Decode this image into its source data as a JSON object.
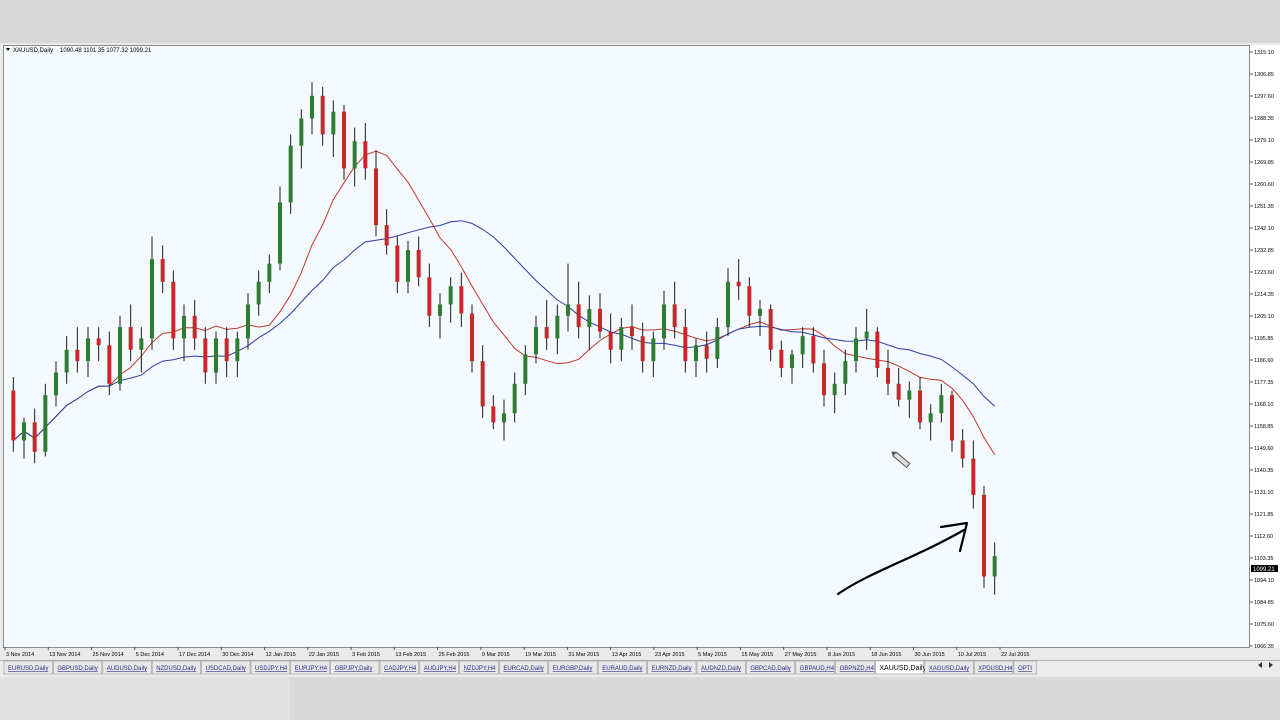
{
  "chart_data": {
    "type": "candlestick",
    "symbol_header": {
      "symbol": "XAUUSD,Daily",
      "ohlc": "1090.48 1101.35 1077.32 1099.21"
    },
    "y_ticks": [
      "1315.10",
      "1306.85",
      "1297.60",
      "1288.35",
      "1279.10",
      "1269.85",
      "1260.60",
      "1251.35",
      "1242.10",
      "1232.85",
      "1223.60",
      "1214.35",
      "1205.10",
      "1195.85",
      "1186.60",
      "1177.35",
      "1168.10",
      "1158.85",
      "1149.60",
      "1140.35",
      "1131.10",
      "1121.85",
      "1112.60",
      "1103.35",
      "1094.10",
      "1084.85",
      "1075.60",
      "1066.35"
    ],
    "current_price": "1099.21",
    "x_ticks": [
      "3 Nov 2014",
      "13 Nov 2014",
      "25 Nov 2014",
      "5 Dec 2014",
      "17 Dec 2014",
      "30 Dec 2014",
      "12 Jan 2015",
      "22 Jan 2015",
      "3 Feb 2015",
      "13 Feb 2015",
      "25 Feb 2015",
      "9 Mar 2015",
      "19 Mar 2015",
      "31 Mar 2015",
      "13 Apr 2015",
      "23 Apr 2015",
      "5 May 2015",
      "15 May 2015",
      "27 May 2015",
      "8 Jun 2015",
      "18 Jun 2015",
      "30 Jun 2015",
      "10 Jul 2015",
      "22 Jul 2015"
    ],
    "ylim": [
      1062,
      1320
    ],
    "colors": {
      "bull": "#2e7d32",
      "bear": "#c62828",
      "ma_fast": "#c0392b",
      "ma_slow": "#2c3e9e"
    },
    "ohlc_series": [
      [
        1172,
        1178,
        1145,
        1150
      ],
      [
        1150,
        1160,
        1142,
        1158
      ],
      [
        1158,
        1164,
        1140,
        1145
      ],
      [
        1145,
        1175,
        1143,
        1170
      ],
      [
        1170,
        1185,
        1165,
        1180
      ],
      [
        1180,
        1196,
        1175,
        1190
      ],
      [
        1190,
        1200,
        1180,
        1185
      ],
      [
        1185,
        1200,
        1178,
        1195
      ],
      [
        1195,
        1200,
        1185,
        1192
      ],
      [
        1192,
        1198,
        1170,
        1175
      ],
      [
        1175,
        1205,
        1172,
        1200
      ],
      [
        1200,
        1210,
        1185,
        1190
      ],
      [
        1190,
        1200,
        1180,
        1195
      ],
      [
        1195,
        1240,
        1190,
        1230
      ],
      [
        1230,
        1236,
        1215,
        1220
      ],
      [
        1220,
        1225,
        1190,
        1195
      ],
      [
        1195,
        1210,
        1185,
        1205
      ],
      [
        1205,
        1212,
        1190,
        1195
      ],
      [
        1195,
        1200,
        1175,
        1180
      ],
      [
        1180,
        1198,
        1175,
        1195
      ],
      [
        1195,
        1200,
        1178,
        1185
      ],
      [
        1185,
        1198,
        1178,
        1195
      ],
      [
        1195,
        1215,
        1190,
        1210
      ],
      [
        1210,
        1225,
        1205,
        1220
      ],
      [
        1220,
        1232,
        1215,
        1228
      ],
      [
        1228,
        1262,
        1225,
        1255
      ],
      [
        1255,
        1285,
        1250,
        1280
      ],
      [
        1280,
        1296,
        1270,
        1292
      ],
      [
        1292,
        1308,
        1285,
        1302
      ],
      [
        1302,
        1306,
        1280,
        1285
      ],
      [
        1285,
        1300,
        1275,
        1295
      ],
      [
        1295,
        1298,
        1265,
        1270
      ],
      [
        1270,
        1288,
        1262,
        1282
      ],
      [
        1282,
        1290,
        1265,
        1270
      ],
      [
        1270,
        1278,
        1240,
        1245
      ],
      [
        1245,
        1252,
        1232,
        1236
      ],
      [
        1236,
        1240,
        1215,
        1220
      ],
      [
        1220,
        1238,
        1215,
        1234
      ],
      [
        1234,
        1240,
        1218,
        1222
      ],
      [
        1222,
        1228,
        1200,
        1205
      ],
      [
        1205,
        1215,
        1195,
        1210
      ],
      [
        1210,
        1222,
        1202,
        1218
      ],
      [
        1218,
        1224,
        1200,
        1206
      ],
      [
        1206,
        1210,
        1180,
        1185
      ],
      [
        1185,
        1192,
        1160,
        1165
      ],
      [
        1165,
        1170,
        1155,
        1158
      ],
      [
        1158,
        1168,
        1150,
        1162
      ],
      [
        1162,
        1180,
        1158,
        1175
      ],
      [
        1175,
        1192,
        1170,
        1188
      ],
      [
        1188,
        1205,
        1184,
        1200
      ],
      [
        1200,
        1212,
        1190,
        1195
      ],
      [
        1195,
        1210,
        1188,
        1205
      ],
      [
        1205,
        1228,
        1198,
        1210
      ],
      [
        1210,
        1220,
        1195,
        1200
      ],
      [
        1200,
        1214,
        1190,
        1208
      ],
      [
        1208,
        1215,
        1195,
        1198
      ],
      [
        1198,
        1206,
        1184,
        1190
      ],
      [
        1190,
        1204,
        1185,
        1200
      ],
      [
        1200,
        1210,
        1190,
        1196
      ],
      [
        1196,
        1202,
        1180,
        1185
      ],
      [
        1185,
        1198,
        1178,
        1195
      ],
      [
        1195,
        1216,
        1190,
        1210
      ],
      [
        1210,
        1220,
        1195,
        1200
      ],
      [
        1200,
        1208,
        1180,
        1185
      ],
      [
        1185,
        1195,
        1178,
        1192
      ],
      [
        1192,
        1198,
        1180,
        1186
      ],
      [
        1186,
        1204,
        1182,
        1200
      ],
      [
        1200,
        1226,
        1196,
        1220
      ],
      [
        1220,
        1230,
        1212,
        1218
      ],
      [
        1218,
        1222,
        1200,
        1205
      ],
      [
        1205,
        1212,
        1196,
        1208
      ],
      [
        1208,
        1210,
        1185,
        1190
      ],
      [
        1190,
        1194,
        1178,
        1182
      ],
      [
        1182,
        1190,
        1175,
        1188
      ],
      [
        1188,
        1200,
        1182,
        1196
      ],
      [
        1196,
        1200,
        1180,
        1184
      ],
      [
        1184,
        1190,
        1165,
        1170
      ],
      [
        1170,
        1180,
        1162,
        1175
      ],
      [
        1175,
        1190,
        1170,
        1185
      ],
      [
        1185,
        1200,
        1180,
        1195
      ],
      [
        1195,
        1208,
        1190,
        1198
      ],
      [
        1198,
        1200,
        1178,
        1182
      ],
      [
        1182,
        1190,
        1170,
        1175
      ],
      [
        1175,
        1182,
        1165,
        1168
      ],
      [
        1168,
        1176,
        1160,
        1172
      ],
      [
        1172,
        1178,
        1155,
        1158
      ],
      [
        1158,
        1166,
        1150,
        1162
      ],
      [
        1162,
        1175,
        1158,
        1170
      ],
      [
        1170,
        1172,
        1145,
        1150
      ],
      [
        1150,
        1155,
        1138,
        1142
      ],
      [
        1142,
        1150,
        1120,
        1126
      ],
      [
        1126,
        1130,
        1085,
        1090
      ],
      [
        1090,
        1105,
        1082,
        1099
      ]
    ],
    "annotation": "hand-drawn arrow pointing to recent low"
  },
  "tabs": [
    {
      "label": "EURUSD,Daily",
      "active": false
    },
    {
      "label": "GBPUSD,Daily",
      "active": false
    },
    {
      "label": "AUDUSD,Daily",
      "active": false
    },
    {
      "label": "NZDUSD,Daily",
      "active": false
    },
    {
      "label": "USDCAD,Daily",
      "active": false
    },
    {
      "label": "USDJPY,H4",
      "active": false
    },
    {
      "label": "EURJPY,H4",
      "active": false
    },
    {
      "label": "GBPJPY,Daily",
      "active": false
    },
    {
      "label": "CADJPY,H4",
      "active": false
    },
    {
      "label": "AUDJPY,H4",
      "active": false
    },
    {
      "label": "NZDJPY,H4",
      "active": false
    },
    {
      "label": "EURCAD,Daily",
      "active": false
    },
    {
      "label": "EURGBP,Daily",
      "active": false
    },
    {
      "label": "EURAUD,Daily",
      "active": false
    },
    {
      "label": "EURNZD,Daily",
      "active": false
    },
    {
      "label": "AUDNZD,Daily",
      "active": false
    },
    {
      "label": "GBPCAD,Daily",
      "active": false
    },
    {
      "label": "GBPAUD,H4",
      "active": false
    },
    {
      "label": "GBPNZD,H4",
      "active": false
    },
    {
      "label": "XAUUSD,Daily",
      "active": true
    },
    {
      "label": "XAGUSD,Daily",
      "active": false
    },
    {
      "label": "XPDUSD,H4",
      "active": false
    },
    {
      "label": "OPTI",
      "active": false
    }
  ]
}
